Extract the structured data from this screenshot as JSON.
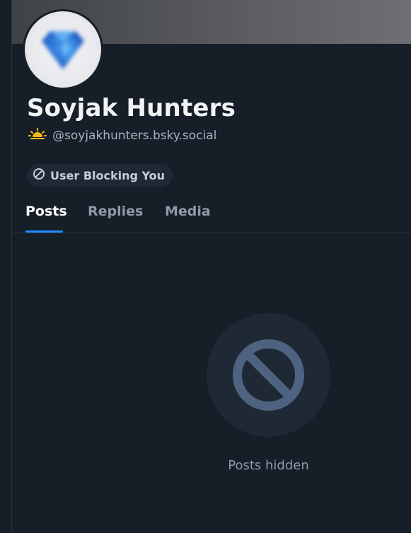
{
  "profile": {
    "display_name": "Soyjak Hunters",
    "handle": "@soyjakhunters.bsky.social",
    "handle_badge_icon": "sun-horizon-icon",
    "status_label": "User Blocking You",
    "status_icon": "blocked-icon"
  },
  "tabs": [
    {
      "label": "Posts",
      "active": true
    },
    {
      "label": "Replies",
      "active": false
    },
    {
      "label": "Media",
      "active": false
    }
  ],
  "empty_state": {
    "icon": "blocked-icon",
    "message": "Posts hidden"
  },
  "colors": {
    "background": "#161e27",
    "accent": "#208bfe",
    "text_primary": "#f1f3f5",
    "text_secondary": "#8e9aa8",
    "pill_bg": "#1f2935",
    "sun": "#f5b91e"
  }
}
